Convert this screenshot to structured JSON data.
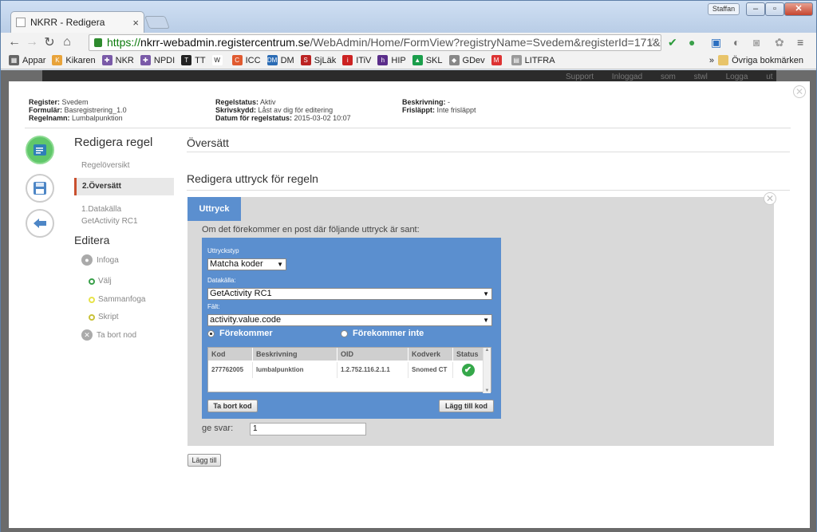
{
  "browser": {
    "tab_title": "NKRR - Redigera",
    "tab_close": "×",
    "ghost_tabs": "",
    "user_button": "Staffan",
    "url_scheme": "https://",
    "url_host": "nkrr-webadmin.registercentrum.se",
    "url_path": "/WebAdmin/Home/FormView?registryName=Svedem&registerId=171&f",
    "bookmarks": [
      {
        "label": "Appar",
        "color": "#666",
        "glyph": "▦"
      },
      {
        "label": "Kikaren",
        "color": "#e8a33a",
        "glyph": "K"
      },
      {
        "label": "NKR",
        "color": "#7a5aa8",
        "glyph": "✚"
      },
      {
        "label": "NPDI",
        "color": "#7a5aa8",
        "glyph": "✚"
      },
      {
        "label": "TT",
        "color": "#222",
        "glyph": "T"
      },
      {
        "label": "",
        "color": "#fff",
        "glyph": "W"
      },
      {
        "label": "ICC",
        "color": "#e05a30",
        "glyph": "C"
      },
      {
        "label": "DM",
        "color": "#2a6bb4",
        "glyph": "DM"
      },
      {
        "label": "SjLäk",
        "color": "#b22",
        "glyph": "S"
      },
      {
        "label": "ITiV",
        "color": "#c22",
        "glyph": "i"
      },
      {
        "label": "HIP",
        "color": "#5a2d8a",
        "glyph": "h"
      },
      {
        "label": "SKL",
        "color": "#1a9e4b",
        "glyph": "▲"
      },
      {
        "label": "GDev",
        "color": "#888",
        "glyph": "◆"
      },
      {
        "label": "",
        "color": "#d33",
        "glyph": "M"
      },
      {
        "label": "LITFRA",
        "color": "#999",
        "glyph": "▤"
      }
    ],
    "other_bookmarks": "Övriga bokmärken",
    "more_bookmarks": "»"
  },
  "page": {
    "ghost_links": "Support  Inloggad som stwl  Logga ut",
    "meta_left": [
      {
        "k": "Register:",
        "v": "Svedem"
      },
      {
        "k": "Formulär:",
        "v": "Basregistrering_1.0"
      },
      {
        "k": "Regelnamn:",
        "v": "Lumbalpunktion"
      }
    ],
    "meta_mid": [
      {
        "k": "Regelstatus:",
        "v": "Aktiv"
      },
      {
        "k": "Skrivskydd:",
        "v": "Låst av dig för editering"
      },
      {
        "k": "Datum för regelstatus:",
        "v": "2015-03-02 10:07"
      }
    ],
    "meta_right": [
      {
        "k": "Beskrivning:",
        "v": "-"
      },
      {
        "k": "Frisläppt:",
        "v": "Inte frisläppt"
      }
    ]
  },
  "sidebar": {
    "heading_edit_rule": "Redigera regel",
    "overview": "Regelöversikt",
    "translate": "2.Översätt",
    "datasource_line1": "1.Datakälla",
    "datasource_line2": "GetActivity RC1",
    "heading_edit": "Editera",
    "insert": "Infoga",
    "choose": "Välj",
    "merge": "Sammanfoga",
    "script": "Skript",
    "remove_node": "Ta bort nod"
  },
  "main": {
    "title": "Översätt",
    "subtitle": "Redigera uttryck för regeln",
    "tab": "Uttryck",
    "intro": "Om det förekommer en post där följande uttryck är sant:",
    "expr_type_label": "Uttryckstyp",
    "expr_type_value": "Matcha koder",
    "datasource_label": "Datakälla:",
    "datasource_value": "GetActivity RC1",
    "field_label": "Fält:",
    "field_value": "activity.value.code",
    "radio_occurs": "Förekommer",
    "radio_not_occurs": "Förekommer inte",
    "columns": [
      "Kod",
      "Beskrivning",
      "OID",
      "Kodverk",
      "Status"
    ],
    "rows": [
      [
        "277762005",
        "lumbalpunktion",
        "1.2.752.116.2.1.1",
        "Snomed CT"
      ]
    ],
    "remove_code": "Ta bort kod",
    "add_code": "Lägg till kod",
    "answer_label": "ge svar:",
    "answer_value": "1",
    "add_button": "Lägg till"
  }
}
